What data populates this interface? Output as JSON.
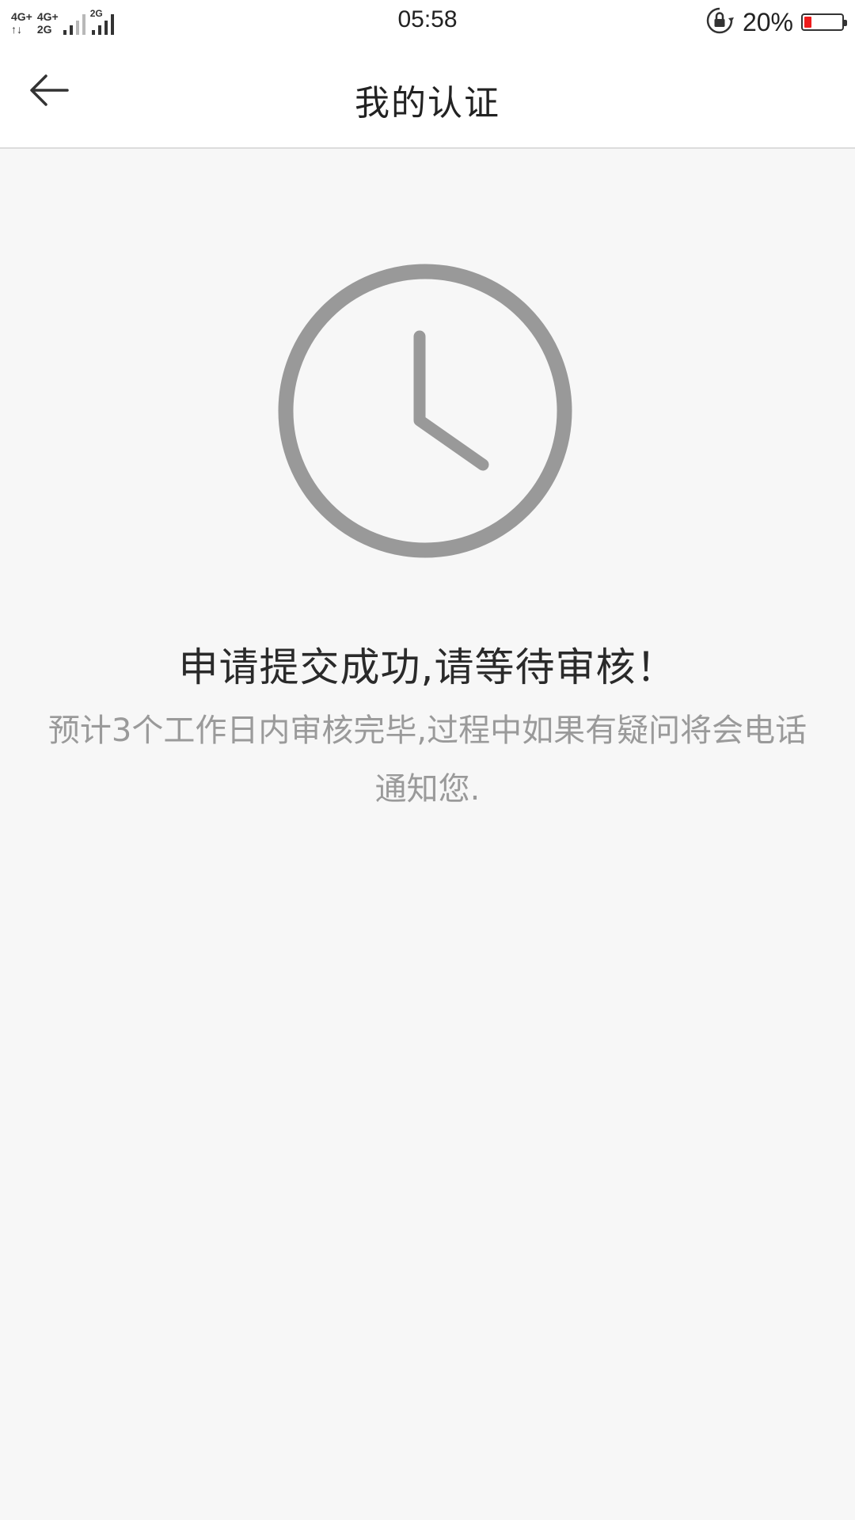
{
  "status_bar": {
    "network_1_top": "4G+",
    "network_1_bottom": "↑↓",
    "network_2_top": "4G+",
    "network_2_bottom": "2G",
    "network_3_top": "2G",
    "time": "05:58",
    "battery_percent": "20%",
    "battery_level": 0.2,
    "battery_color": "#ee1c1c"
  },
  "nav": {
    "title": "我的认证",
    "back_icon": "arrow-left-icon"
  },
  "content": {
    "status_icon": "clock-icon",
    "icon_color": "#999999",
    "title": "申请提交成功,请等待审核！",
    "description": "预计3个工作日内审核完毕,过程中如果有疑问将会电话通知您."
  }
}
